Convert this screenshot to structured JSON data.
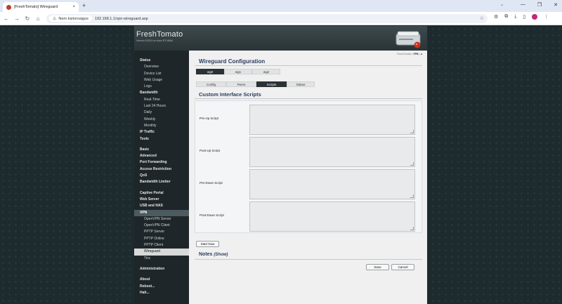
{
  "browser": {
    "tab_title": "[FreshTomato] Wireguard",
    "tab_close": "×",
    "new_tab": "+",
    "security_label": "Nem biztonságos",
    "url": "192.168.1.1/vpn-wireguard.asp",
    "window_controls": [
      "—",
      "❐",
      "✕"
    ]
  },
  "banner": {
    "brand": "FreshTomato",
    "version": "Version 2023.5 on Asus RT-N66U"
  },
  "sidebar": {
    "items": [
      {
        "label": "Status",
        "kind": "group"
      },
      {
        "label": "Overview",
        "kind": "sub"
      },
      {
        "label": "Device List",
        "kind": "sub"
      },
      {
        "label": "Web Usage",
        "kind": "sub"
      },
      {
        "label": "Logs",
        "kind": "sub"
      },
      {
        "label": "Bandwidth",
        "kind": "group"
      },
      {
        "label": "Real-Time",
        "kind": "sub"
      },
      {
        "label": "Last 24 Hours",
        "kind": "sub"
      },
      {
        "label": "Daily",
        "kind": "sub"
      },
      {
        "label": "Weekly",
        "kind": "sub"
      },
      {
        "label": "Monthly",
        "kind": "sub"
      },
      {
        "label": "IP Traffic",
        "kind": "group"
      },
      {
        "label": "Tools",
        "kind": "group"
      },
      {
        "label": "",
        "kind": "gap"
      },
      {
        "label": "Basic",
        "kind": "group"
      },
      {
        "label": "Advanced",
        "kind": "group"
      },
      {
        "label": "Port Forwarding",
        "kind": "group"
      },
      {
        "label": "Access Restriction",
        "kind": "group"
      },
      {
        "label": "QoS",
        "kind": "group"
      },
      {
        "label": "Bandwidth Limiter",
        "kind": "group"
      },
      {
        "label": "",
        "kind": "gap"
      },
      {
        "label": "Captive Portal",
        "kind": "group"
      },
      {
        "label": "Web Server",
        "kind": "group"
      },
      {
        "label": "USB and NAS",
        "kind": "group"
      },
      {
        "label": "VPN",
        "kind": "group",
        "state": "active"
      },
      {
        "label": "OpenVPN Server",
        "kind": "sub"
      },
      {
        "label": "OpenVPN Client",
        "kind": "sub"
      },
      {
        "label": "PPTP Server",
        "kind": "sub"
      },
      {
        "label": "PPTP Online",
        "kind": "sub"
      },
      {
        "label": "PPTP Client",
        "kind": "sub"
      },
      {
        "label": "Wireguard",
        "kind": "sub",
        "state": "selected"
      },
      {
        "label": "Tinc",
        "kind": "sub"
      },
      {
        "label": "",
        "kind": "gap"
      },
      {
        "label": "Administration",
        "kind": "group"
      },
      {
        "label": "",
        "kind": "gap"
      },
      {
        "label": "About",
        "kind": "group"
      },
      {
        "label": "Reboot...",
        "kind": "group"
      },
      {
        "label": "Halt...",
        "kind": "group"
      }
    ]
  },
  "breadcrumb": {
    "prefix": "FreshTomato |",
    "current": "VPN",
    "suffix": "| ◀"
  },
  "main": {
    "title": "Wireguard Configuration",
    "interfaces": [
      "wg0",
      "wg1",
      "wg2"
    ],
    "active_interface": 0,
    "subtabs": [
      "Config",
      "Peers",
      "Scripts",
      "Status"
    ],
    "active_subtab": 2,
    "section_title": "Custom Interface Scripts",
    "scripts": [
      {
        "label": "Pre-Up Script",
        "value": ""
      },
      {
        "label": "Post-Up Script",
        "value": ""
      },
      {
        "label": "Pre-Down Script",
        "value": ""
      },
      {
        "label": "Post-Down Script",
        "value": ""
      }
    ],
    "start_now": "Start Now",
    "notes_title": "Notes",
    "notes_toggle": "(Show)",
    "save": "Save",
    "cancel": "Cancel"
  },
  "colors": {
    "heading": "#2b3d5e",
    "active_tab": "#2b3235",
    "sidebar_bg": "#1f2629"
  }
}
